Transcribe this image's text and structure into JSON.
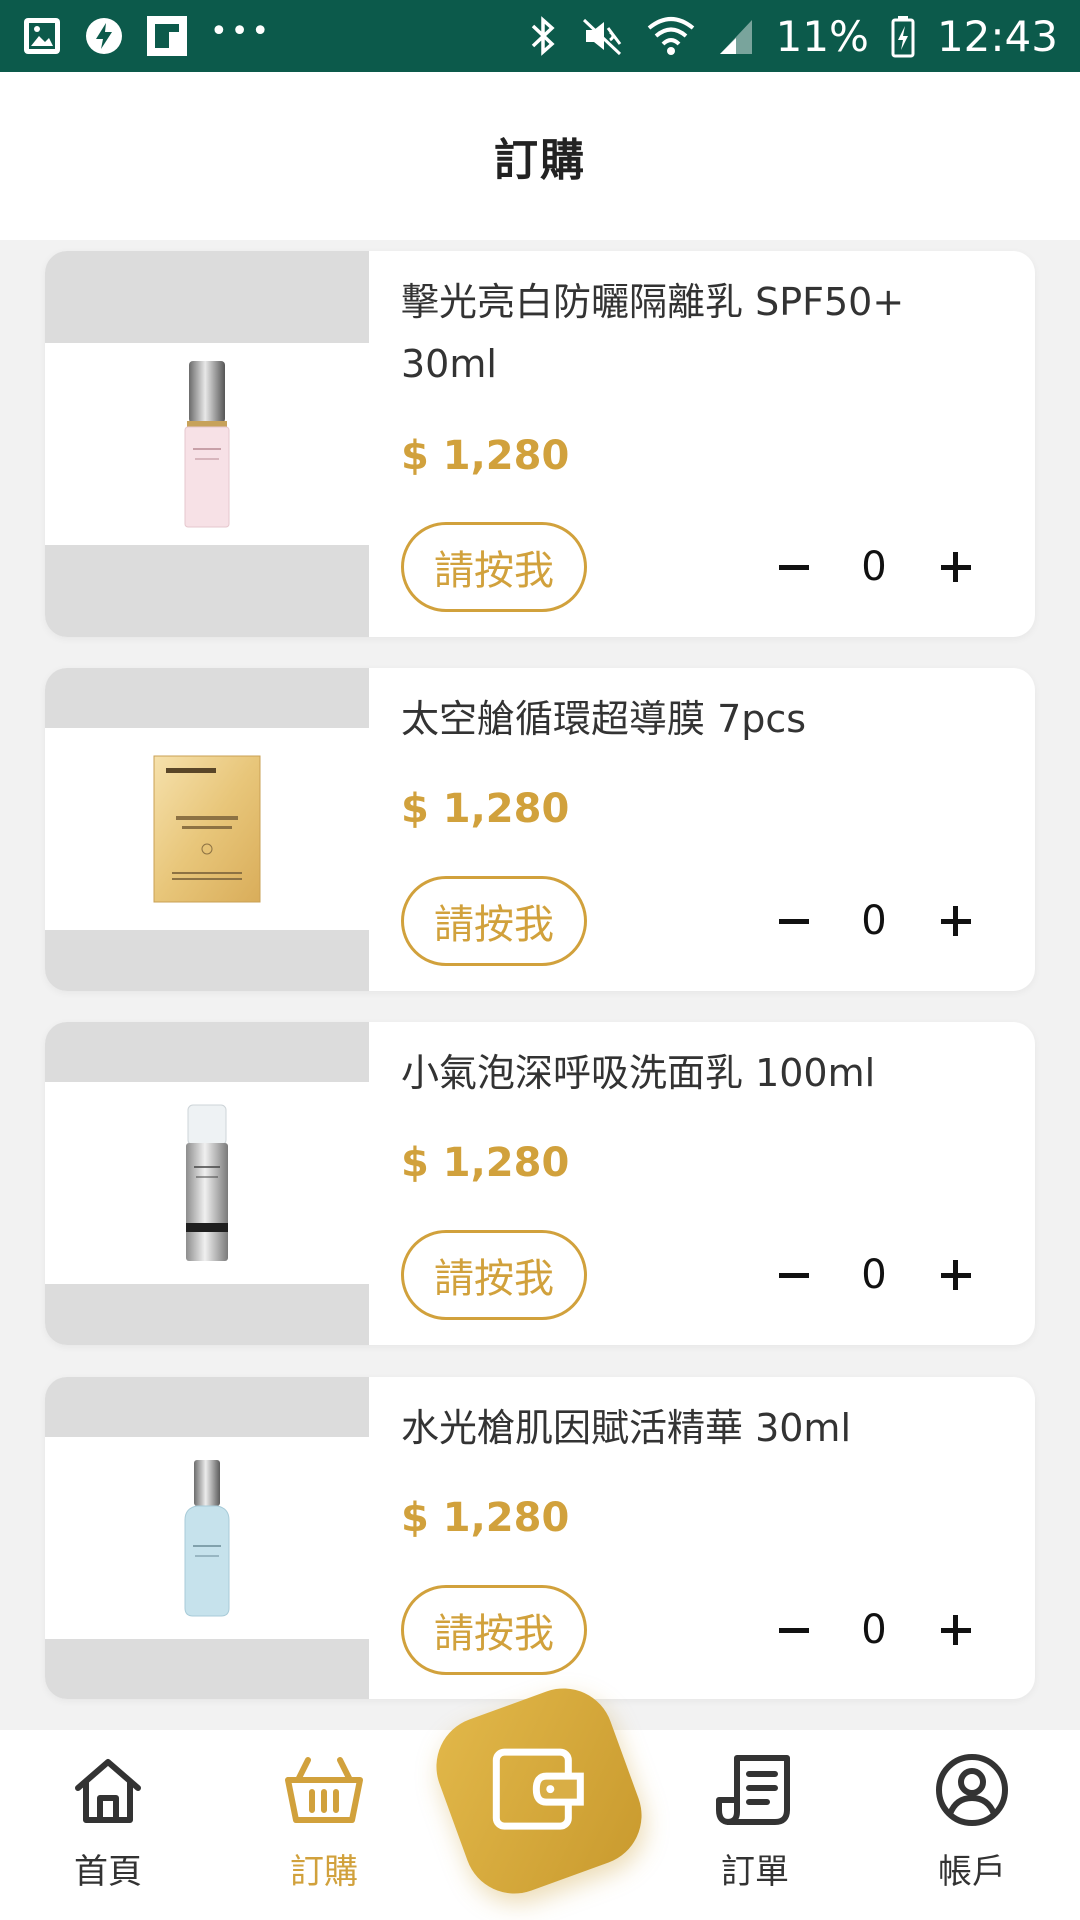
{
  "status_bar": {
    "battery": "11%",
    "time": "12:43"
  },
  "header": {
    "title": "訂購"
  },
  "products": [
    {
      "name": "擊光亮白防曬隔離乳 SPF50+ 30ml",
      "price": "$ 1,280",
      "button": "請按我",
      "qty": "0",
      "image": "pink-serum-bottle"
    },
    {
      "name": "太空艙循環超導膜 7pcs",
      "price": "$ 1,280",
      "button": "請按我",
      "qty": "0",
      "image": "gold-mask-sachet"
    },
    {
      "name": "小氣泡深呼吸洗面乳 100ml",
      "price": "$ 1,280",
      "button": "請按我",
      "qty": "0",
      "image": "silver-pump-bottle"
    },
    {
      "name": "水光槍肌因賦活精華 30ml",
      "price": "$ 1,280",
      "button": "請按我",
      "qty": "0",
      "image": "blue-serum-bottle"
    }
  ],
  "nav": {
    "items": [
      {
        "label": "首頁",
        "icon": "home-icon"
      },
      {
        "label": "訂購",
        "icon": "basket-icon"
      },
      {
        "label": "訂單",
        "icon": "receipt-icon"
      },
      {
        "label": "帳戶",
        "icon": "user-icon"
      }
    ],
    "center_icon": "wallet-icon"
  },
  "colors": {
    "accent": "#d1a13c",
    "status_bar": "#0c5a4b"
  }
}
